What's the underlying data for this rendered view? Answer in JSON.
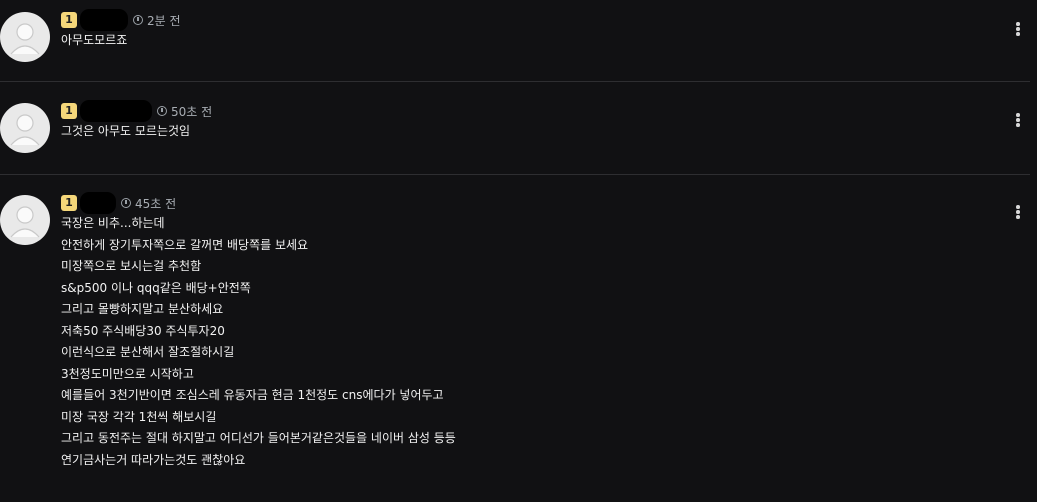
{
  "comments": [
    {
      "level": "1",
      "time": "2분 전",
      "lines": [
        "아무도모르죠"
      ]
    },
    {
      "level": "1",
      "time": "50초 전",
      "lines": [
        "그것은 아무도 모르는것임"
      ]
    },
    {
      "level": "1",
      "time": "45초 전",
      "lines": [
        "국장은 비추...하는데",
        "안전하게 장기투자쪽으로 갈꺼면 배당쪽를 보세요",
        "미장쪽으로 보시는걸 추천함",
        "s&p500 이나 qqq같은 배당+안전쪽",
        "그리고 몰빵하지말고 분산하세요",
        "저축50 주식배당30 주식투자20",
        "이런식으로 분산해서 잘조절하시길",
        "3천정도미만으로 시작하고",
        "예를들어 3천기반이면 조심스레 유동자금 현금 1천정도 cns에다가 넣어두고",
        "미장 국장 각각 1천씩 해보시길",
        "그리고 동전주는 절대 하지말고 어디선가 들어본거같은것들을 네이버 삼성 등등",
        "연기금사는거 따라가는것도 괜찮아요"
      ]
    }
  ],
  "icons": {
    "time": "clock-icon",
    "more": "more-vertical-icon",
    "avatar": "default-avatar-icon"
  },
  "colors": {
    "background": "#111113",
    "level_badge": "#f5d77a",
    "meta_text": "#a8adb3",
    "divider": "#2e2e31"
  }
}
